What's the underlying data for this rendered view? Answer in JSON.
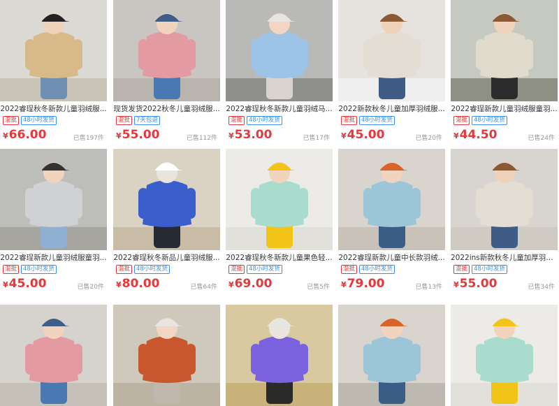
{
  "products": [
    {
      "title": "2022睿珵秋冬新款儿童羽绒服...",
      "tags": [
        "混批",
        "48小时发货"
      ],
      "yen": "¥",
      "price": "66.00",
      "sold": "已售197件",
      "photo": {
        "bg": "#dcdad5",
        "floor": "#c9c3b8",
        "coat": "#d8b98a",
        "hat": "#222222",
        "pants": "#6f90b3",
        "skin": "#f0d2bb"
      }
    },
    {
      "title": "现货发货2022秋冬儿童羽绒服...",
      "tags": [
        "混批",
        "7天包退"
      ],
      "yen": "¥",
      "price": "55.00",
      "sold": "已售112件",
      "photo": {
        "bg": "#c9c6c2",
        "floor": "#b9b5ae",
        "coat": "#e39aa3",
        "hat": "#3e5e88",
        "pants": "#4a78b0",
        "skin": "#f2d3bd"
      }
    },
    {
      "title": "2022睿珵秋冬新款儿童羽绒马...",
      "tags": [
        "混批",
        "48小时发货"
      ],
      "yen": "¥",
      "price": "53.00",
      "sold": "已售17件",
      "photo": {
        "bg": "#b9b9b7",
        "floor": "#8f8f8c",
        "coat": "#9dc3e6",
        "hat": "#e8e6e1",
        "pants": "#d9d5ce",
        "skin": "#f2d6c3"
      }
    },
    {
      "title": "2022新款秋冬儿童加厚羽绒服...",
      "tags": [
        "混批",
        "48小时发货"
      ],
      "yen": "¥",
      "price": "45.00",
      "sold": "已售20件",
      "photo": {
        "bg": "#e6e3df",
        "floor": "#efefef",
        "coat": "#e3ddd4",
        "hat": "#8a5a37",
        "pants": "#3e5c86",
        "skin": "#f0d2bb"
      }
    },
    {
      "title": "2022睿珵新款儿童羽绒服童羽...",
      "tags": [
        "混批",
        "48小时发货"
      ],
      "yen": "¥",
      "price": "44.50",
      "sold": "已售24件",
      "photo": {
        "bg": "#c6c9c0",
        "floor": "#8e9083",
        "coat": "#e0dbcc",
        "hat": "#8a5a37",
        "pants": "#2b2b2b",
        "skin": "#f1d4be"
      }
    },
    {
      "title": "2022睿珵新款儿童羽绒服童羽...",
      "tags": [
        "混批",
        "48小时发货"
      ],
      "yen": "¥",
      "price": "45.00",
      "sold": "已售20件",
      "photo": {
        "bg": "#bdbdb9",
        "floor": "#a6a59f",
        "coat": "#cfd1d3",
        "hat": "#333333",
        "pants": "#8fb0d0",
        "skin": "#f1d4be"
      }
    },
    {
      "title": "2022睿珵秋冬新品儿童羽绒服...",
      "tags": [
        "混批",
        "48小时发货"
      ],
      "yen": "¥",
      "price": "80.00",
      "sold": "已售64件",
      "photo": {
        "bg": "#dad2c3",
        "floor": "#c8bca6",
        "coat": "#3a5fcc",
        "hat": "#ffffff",
        "pants": "#262a33",
        "skin": "#e9e4dc"
      }
    },
    {
      "title": "2022睿珵秋冬新款儿童果色轻...",
      "tags": [
        "混批",
        "48小时发货"
      ],
      "yen": "¥",
      "price": "69.00",
      "sold": "已售5件",
      "photo": {
        "bg": "#ecebe7",
        "floor": "#e2e0db",
        "coat": "#a9dccc",
        "hat": "#f2c418",
        "pants": "#f2c418",
        "skin": "#f2d3bd"
      }
    },
    {
      "title": "2022睿珵新款儿童中长款羽绒...",
      "tags": [
        "混批",
        "48小时发货"
      ],
      "yen": "¥",
      "price": "79.00",
      "sold": "已售13件",
      "photo": {
        "bg": "#d9d4cd",
        "floor": "#c8c2b9",
        "coat": "#9cc6d8",
        "hat": "#d8642c",
        "pants": "#3a5d87",
        "skin": "#f1d4be"
      }
    },
    {
      "title": "2022ins新款秋冬儿童加厚羽绒...",
      "tags": [
        "混批",
        "48小时发货"
      ],
      "yen": "¥",
      "price": "55.00",
      "sold": "已售34件",
      "photo": {
        "bg": "#d8d5d0",
        "floor": "#cfcac2",
        "coat": "#e3ddd4",
        "hat": "#8a5a37",
        "pants": "#3e5c86",
        "skin": "#f0d2bb"
      }
    },
    {
      "title": "",
      "tags": [],
      "yen": "",
      "price": "",
      "sold": "",
      "photo": {
        "bg": "#d6d3cf",
        "floor": "#c5c0b8",
        "coat": "#e39aa3",
        "hat": "#3e5e88",
        "pants": "#4a78b0",
        "skin": "#f2d3bd"
      }
    },
    {
      "title": "",
      "tags": [],
      "yen": "",
      "price": "",
      "sold": "",
      "photo": {
        "bg": "#cfc8bd",
        "floor": "#bdb3a3",
        "coat": "#c9572e",
        "hat": "#e8e6e1",
        "pants": "#c0b8ad",
        "skin": "#f2d6c3"
      }
    },
    {
      "title": "",
      "tags": [],
      "yen": "",
      "price": "",
      "sold": "",
      "photo": {
        "bg": "#d9c9a0",
        "floor": "#c9b27a",
        "coat": "#7b63e0",
        "hat": "#e8e6e1",
        "pants": "#2a2a2a",
        "skin": "#e9e4dc"
      }
    },
    {
      "title": "",
      "tags": [],
      "yen": "",
      "price": "",
      "sold": "",
      "photo": {
        "bg": "#d9d4cd",
        "floor": "#bdb8b0",
        "coat": "#9cc6d8",
        "hat": "#d8642c",
        "pants": "#3a5d87",
        "skin": "#f1d4be"
      }
    },
    {
      "title": "",
      "tags": [],
      "yen": "",
      "price": "",
      "sold": "",
      "photo": {
        "bg": "#ecebe7",
        "floor": "#e2e0db",
        "coat": "#a9dccc",
        "hat": "#f2c418",
        "pants": "#f2c418",
        "skin": "#f2d3bd"
      }
    }
  ]
}
